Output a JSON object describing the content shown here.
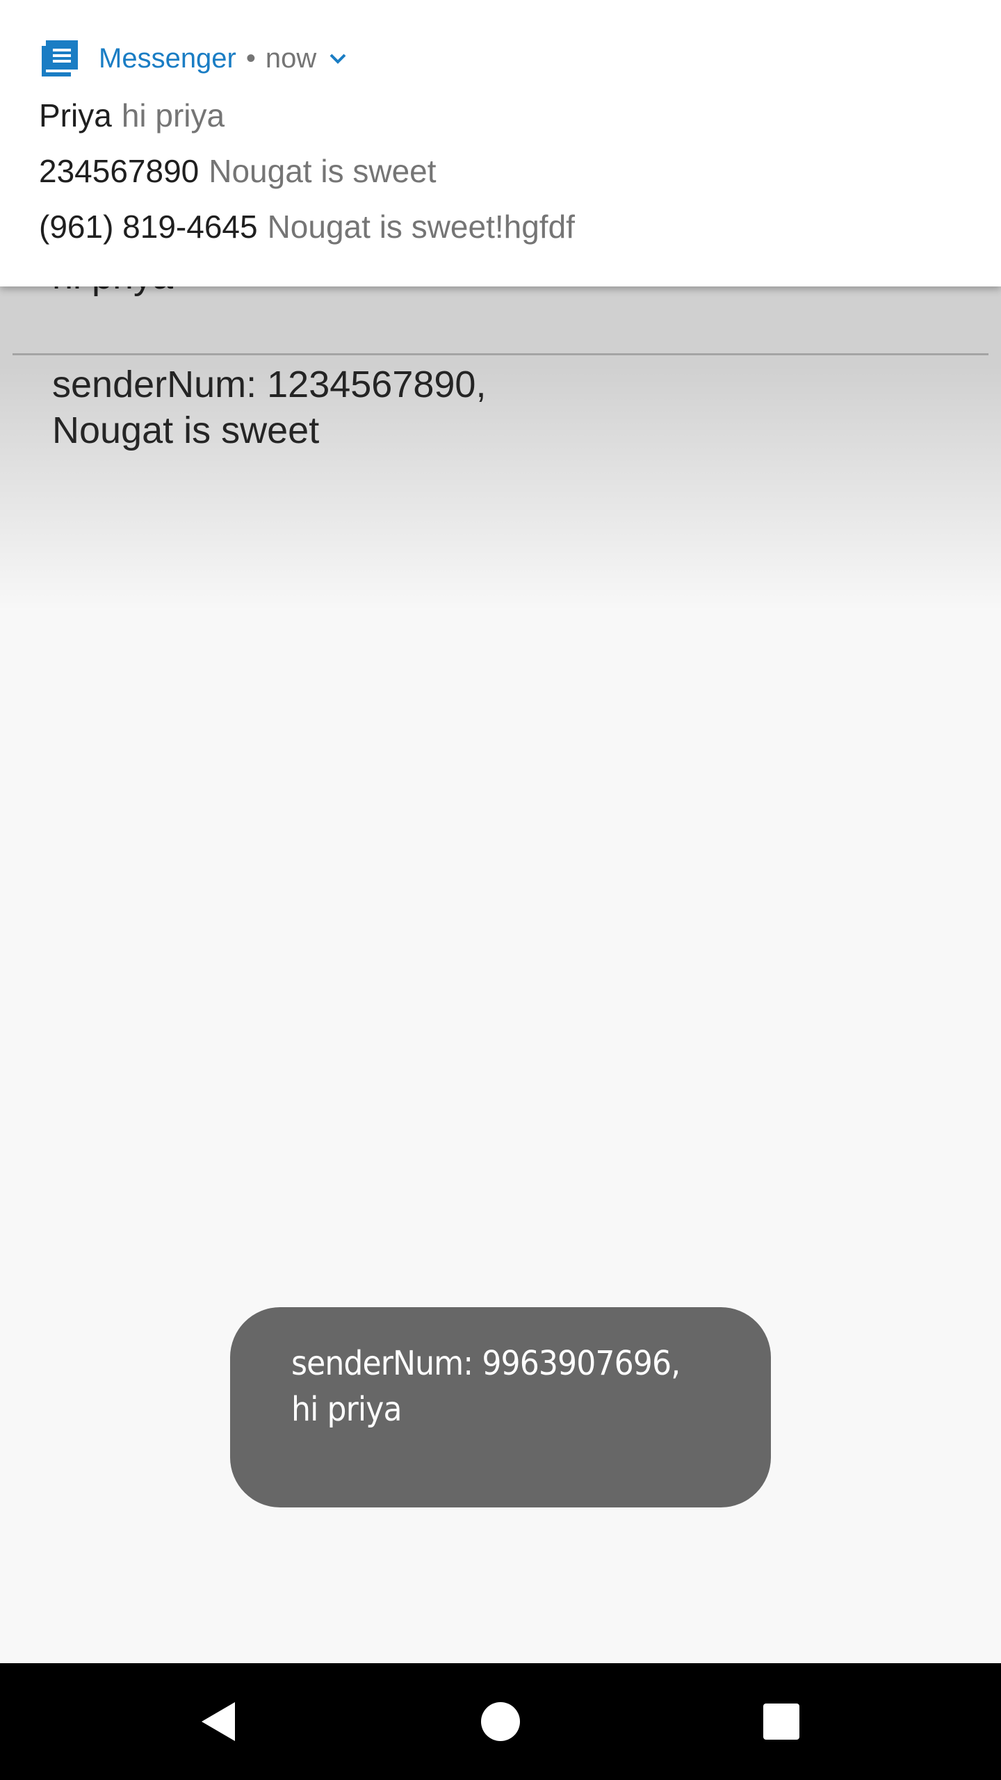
{
  "notification": {
    "app_icon": "messenger-app-icon",
    "app_name": "Messenger",
    "separator": "•",
    "time": "now",
    "expand_icon": "chevron-down-icon",
    "accent_color": "#1a7dc4",
    "messages": [
      {
        "sender": "Priya",
        "preview": "hi priya"
      },
      {
        "sender": "234567890",
        "preview": "Nougat is sweet"
      },
      {
        "sender": "(961) 819-4645",
        "preview": "Nougat is sweet!hgfdf"
      }
    ]
  },
  "app": {
    "messages": [
      {
        "text": "hi priya"
      },
      {
        "text": "senderNum:  1234567890,\nNougat is sweet"
      }
    ]
  },
  "toast": {
    "text": "senderNum:  9963907696,\nhi priya"
  },
  "navbar": {
    "back_icon": "back-triangle-icon",
    "home_icon": "home-circle-icon",
    "recents_icon": "recents-square-icon"
  }
}
